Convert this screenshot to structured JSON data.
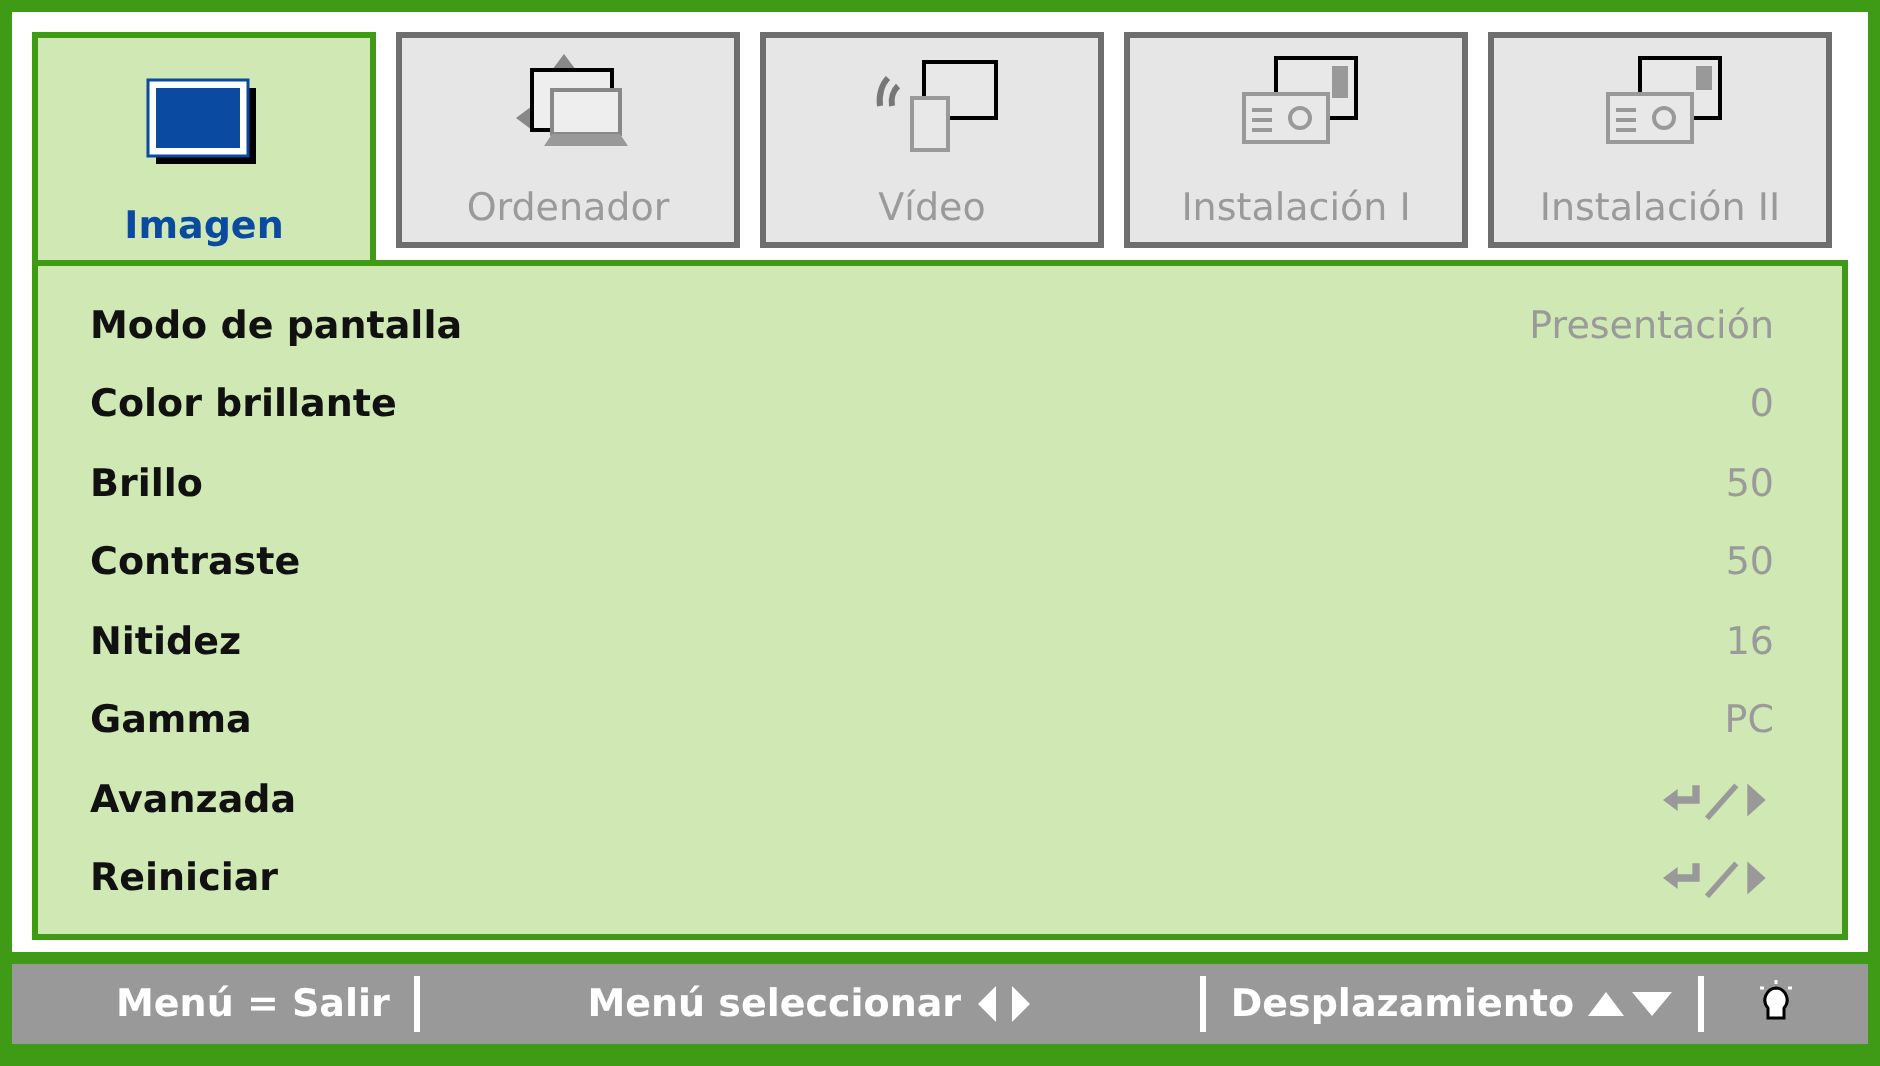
{
  "tabs": [
    {
      "label": "Imagen",
      "selected": true
    },
    {
      "label": "Ordenador",
      "selected": false
    },
    {
      "label": "Vídeo",
      "selected": false
    },
    {
      "label": "Instalación I",
      "selected": false
    },
    {
      "label": "Instalación II",
      "selected": false
    }
  ],
  "rows": [
    {
      "label": "Modo de pantalla",
      "kind": "text",
      "value": "Presentación"
    },
    {
      "label": "Color brillante",
      "kind": "text",
      "value": "0"
    },
    {
      "label": "Brillo",
      "kind": "text",
      "value": "50"
    },
    {
      "label": "Contraste",
      "kind": "text",
      "value": "50"
    },
    {
      "label": "Nitidez",
      "kind": "text",
      "value": "16"
    },
    {
      "label": "Gamma",
      "kind": "text",
      "value": "PC"
    },
    {
      "label": "Avanzada",
      "kind": "submenu"
    },
    {
      "label": "Reiniciar",
      "kind": "submenu"
    }
  ],
  "status_bar": [
    {
      "text": "Menú = Salir",
      "kind": "plain"
    },
    {
      "text": "Menú seleccionar",
      "kind": "leftright"
    },
    {
      "text": "Desplazamiento",
      "kind": "updown"
    },
    {
      "kind": "bulb"
    }
  ]
}
